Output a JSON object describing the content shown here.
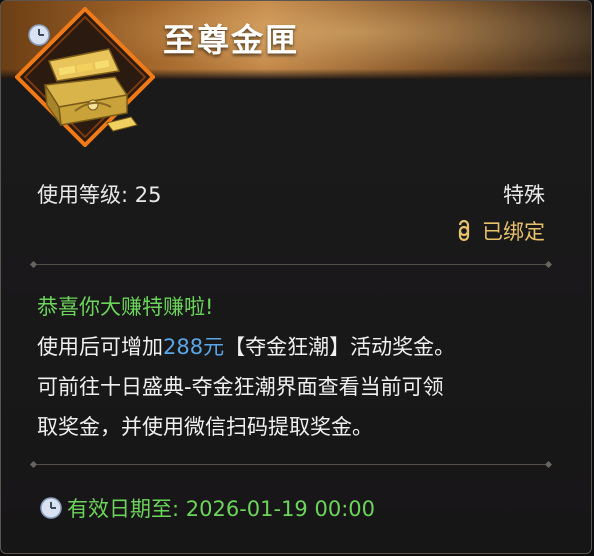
{
  "item": {
    "name": "至尊金匣",
    "icon": "golden-treasure-chest",
    "level_label": "使用等级: 25",
    "rarity": "特殊",
    "bound_status": "已绑定"
  },
  "description": {
    "headline": "恭喜你大赚特赚啦!",
    "line1_prefix": "使用后可增加",
    "line1_highlight": "288元",
    "line1_suffix": "【夺金狂潮】活动奖金。",
    "line2": "可前往十日盛典-夺金狂潮界面查看当前可领",
    "line3": "取奖金，并使用微信扫码提取奖金。"
  },
  "expiry": {
    "label": "有效日期至: 2026-01-19 00:00"
  },
  "colors": {
    "green": "#6bd45a",
    "blue": "#5aa6e8",
    "gold": "#e8c26a",
    "icon_border": "#f07a18"
  }
}
